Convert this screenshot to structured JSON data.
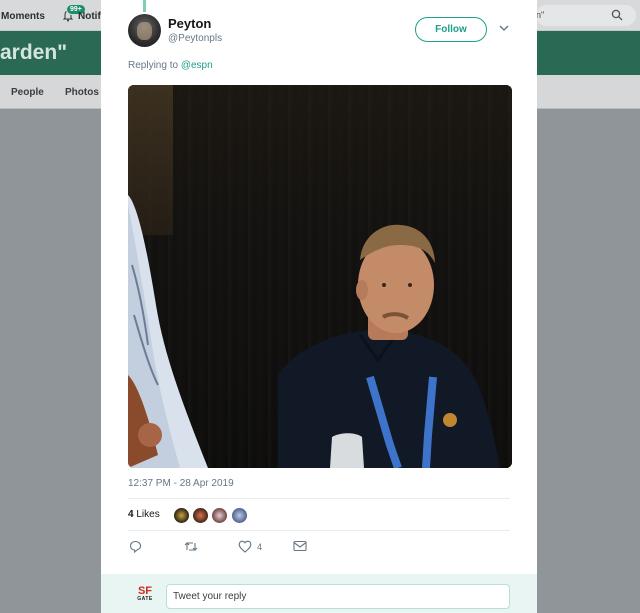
{
  "background": {
    "nav": {
      "moments_label": "Moments",
      "notifications_badge": "99+",
      "notifications_label": "Notif",
      "search_text": "n\""
    },
    "banner_title": "arden\"",
    "tabs": [
      "People",
      "Photos"
    ]
  },
  "tweet": {
    "name": "Peyton",
    "handle": "@Peytonpls",
    "follow_label": "Follow",
    "replying_prefix": "Replying to",
    "replying_mention": "@espn",
    "timestamp": "12:37 PM - 28 Apr 2019",
    "likes_count": "4",
    "likes_label": "Likes",
    "like_action_count": "4"
  },
  "reply": {
    "logo_sf": "SF",
    "logo_gate": "GATE",
    "placeholder": "Tweet your reply"
  },
  "colors": {
    "accent": "#1da18a",
    "banner": "#2a6a55"
  }
}
